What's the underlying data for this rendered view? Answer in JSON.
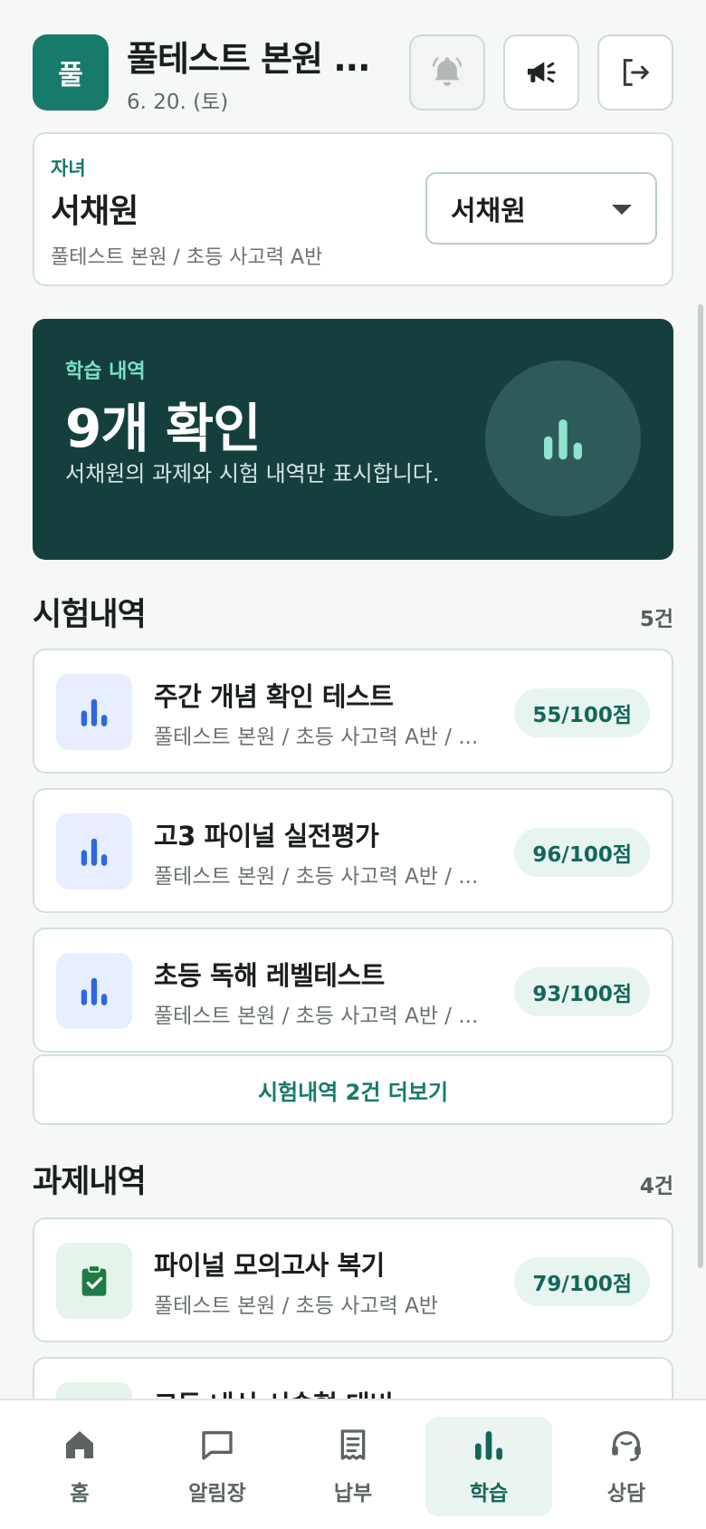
{
  "header": {
    "badge": "풀",
    "title": "풀테스트 본원 ...",
    "date": "6. 20. (토)",
    "icons": [
      "bell-icon",
      "megaphone-icon",
      "logout-icon"
    ]
  },
  "child": {
    "label": "자녀",
    "name": "서채원",
    "sub": "풀테스트 본원 / 초등 사고력 A반",
    "selected": "서채원"
  },
  "hero": {
    "label": "학습 내역",
    "title": "9개 확인",
    "desc": "서채원의 과제와 시험 내역만 표시합니다."
  },
  "exams": {
    "title": "시험내역",
    "count": "5건",
    "items": [
      {
        "title": "주간 개념 확인 테스트",
        "sub": "풀테스트 본원 / 초등 사고력 A반 / ...",
        "score": "55/100점"
      },
      {
        "title": "고3 파이널 실전평가",
        "sub": "풀테스트 본원 / 초등 사고력 A반 / ...",
        "score": "96/100점"
      },
      {
        "title": "초등 독해 레벨테스트",
        "sub": "풀테스트 본원 / 초등 사고력 A반 / ...",
        "score": "93/100점"
      }
    ],
    "more": "시험내역 2건 더보기"
  },
  "assignments": {
    "title": "과제내역",
    "count": "4건",
    "items": [
      {
        "title": "파이널 모의고사 복기",
        "sub": "풀테스트 본원 / 초등 사고력 A반",
        "score": "79/100점"
      },
      {
        "title": "고등 내신 서술형 대비",
        "sub": "",
        "score": ""
      }
    ]
  },
  "nav": {
    "items": [
      {
        "label": "홈",
        "icon": "home-icon"
      },
      {
        "label": "알림장",
        "icon": "message-icon"
      },
      {
        "label": "납부",
        "icon": "receipt-icon"
      },
      {
        "label": "학습",
        "icon": "chart-icon"
      },
      {
        "label": "상담",
        "icon": "headset-icon"
      }
    ],
    "active": "학습"
  },
  "colors": {
    "primary": "#177a6a",
    "hero_bg": "#153f3c",
    "exam_icon": "#2f67e0"
  }
}
